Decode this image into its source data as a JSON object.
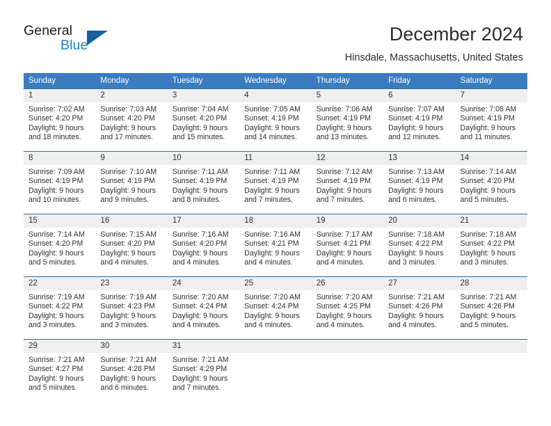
{
  "brand": {
    "name_top": "General",
    "name_bottom": "Blue",
    "accent_color": "#1a7fd4",
    "triangle_color": "#15619e"
  },
  "header": {
    "title": "December 2024",
    "location": "Hinsdale, Massachusetts, United States"
  },
  "calendar": {
    "header_bg": "#3b7cbf",
    "daynum_bg": "#efefef",
    "row_border_color": "#2e6da4",
    "weekdays": [
      "Sunday",
      "Monday",
      "Tuesday",
      "Wednesday",
      "Thursday",
      "Friday",
      "Saturday"
    ],
    "weeks": [
      [
        {
          "day": "1",
          "sunrise": "Sunrise: 7:02 AM",
          "sunset": "Sunset: 4:20 PM",
          "daylight": "Daylight: 9 hours and 18 minutes."
        },
        {
          "day": "2",
          "sunrise": "Sunrise: 7:03 AM",
          "sunset": "Sunset: 4:20 PM",
          "daylight": "Daylight: 9 hours and 17 minutes."
        },
        {
          "day": "3",
          "sunrise": "Sunrise: 7:04 AM",
          "sunset": "Sunset: 4:20 PM",
          "daylight": "Daylight: 9 hours and 15 minutes."
        },
        {
          "day": "4",
          "sunrise": "Sunrise: 7:05 AM",
          "sunset": "Sunset: 4:19 PM",
          "daylight": "Daylight: 9 hours and 14 minutes."
        },
        {
          "day": "5",
          "sunrise": "Sunrise: 7:06 AM",
          "sunset": "Sunset: 4:19 PM",
          "daylight": "Daylight: 9 hours and 13 minutes."
        },
        {
          "day": "6",
          "sunrise": "Sunrise: 7:07 AM",
          "sunset": "Sunset: 4:19 PM",
          "daylight": "Daylight: 9 hours and 12 minutes."
        },
        {
          "day": "7",
          "sunrise": "Sunrise: 7:08 AM",
          "sunset": "Sunset: 4:19 PM",
          "daylight": "Daylight: 9 hours and 11 minutes."
        }
      ],
      [
        {
          "day": "8",
          "sunrise": "Sunrise: 7:09 AM",
          "sunset": "Sunset: 4:19 PM",
          "daylight": "Daylight: 9 hours and 10 minutes."
        },
        {
          "day": "9",
          "sunrise": "Sunrise: 7:10 AM",
          "sunset": "Sunset: 4:19 PM",
          "daylight": "Daylight: 9 hours and 9 minutes."
        },
        {
          "day": "10",
          "sunrise": "Sunrise: 7:11 AM",
          "sunset": "Sunset: 4:19 PM",
          "daylight": "Daylight: 9 hours and 8 minutes."
        },
        {
          "day": "11",
          "sunrise": "Sunrise: 7:11 AM",
          "sunset": "Sunset: 4:19 PM",
          "daylight": "Daylight: 9 hours and 7 minutes."
        },
        {
          "day": "12",
          "sunrise": "Sunrise: 7:12 AM",
          "sunset": "Sunset: 4:19 PM",
          "daylight": "Daylight: 9 hours and 7 minutes."
        },
        {
          "day": "13",
          "sunrise": "Sunrise: 7:13 AM",
          "sunset": "Sunset: 4:19 PM",
          "daylight": "Daylight: 9 hours and 6 minutes."
        },
        {
          "day": "14",
          "sunrise": "Sunrise: 7:14 AM",
          "sunset": "Sunset: 4:20 PM",
          "daylight": "Daylight: 9 hours and 5 minutes."
        }
      ],
      [
        {
          "day": "15",
          "sunrise": "Sunrise: 7:14 AM",
          "sunset": "Sunset: 4:20 PM",
          "daylight": "Daylight: 9 hours and 5 minutes."
        },
        {
          "day": "16",
          "sunrise": "Sunrise: 7:15 AM",
          "sunset": "Sunset: 4:20 PM",
          "daylight": "Daylight: 9 hours and 4 minutes."
        },
        {
          "day": "17",
          "sunrise": "Sunrise: 7:16 AM",
          "sunset": "Sunset: 4:20 PM",
          "daylight": "Daylight: 9 hours and 4 minutes."
        },
        {
          "day": "18",
          "sunrise": "Sunrise: 7:16 AM",
          "sunset": "Sunset: 4:21 PM",
          "daylight": "Daylight: 9 hours and 4 minutes."
        },
        {
          "day": "19",
          "sunrise": "Sunrise: 7:17 AM",
          "sunset": "Sunset: 4:21 PM",
          "daylight": "Daylight: 9 hours and 4 minutes."
        },
        {
          "day": "20",
          "sunrise": "Sunrise: 7:18 AM",
          "sunset": "Sunset: 4:22 PM",
          "daylight": "Daylight: 9 hours and 3 minutes."
        },
        {
          "day": "21",
          "sunrise": "Sunrise: 7:18 AM",
          "sunset": "Sunset: 4:22 PM",
          "daylight": "Daylight: 9 hours and 3 minutes."
        }
      ],
      [
        {
          "day": "22",
          "sunrise": "Sunrise: 7:19 AM",
          "sunset": "Sunset: 4:22 PM",
          "daylight": "Daylight: 9 hours and 3 minutes."
        },
        {
          "day": "23",
          "sunrise": "Sunrise: 7:19 AM",
          "sunset": "Sunset: 4:23 PM",
          "daylight": "Daylight: 9 hours and 3 minutes."
        },
        {
          "day": "24",
          "sunrise": "Sunrise: 7:20 AM",
          "sunset": "Sunset: 4:24 PM",
          "daylight": "Daylight: 9 hours and 4 minutes."
        },
        {
          "day": "25",
          "sunrise": "Sunrise: 7:20 AM",
          "sunset": "Sunset: 4:24 PM",
          "daylight": "Daylight: 9 hours and 4 minutes."
        },
        {
          "day": "26",
          "sunrise": "Sunrise: 7:20 AM",
          "sunset": "Sunset: 4:25 PM",
          "daylight": "Daylight: 9 hours and 4 minutes."
        },
        {
          "day": "27",
          "sunrise": "Sunrise: 7:21 AM",
          "sunset": "Sunset: 4:26 PM",
          "daylight": "Daylight: 9 hours and 4 minutes."
        },
        {
          "day": "28",
          "sunrise": "Sunrise: 7:21 AM",
          "sunset": "Sunset: 4:26 PM",
          "daylight": "Daylight: 9 hours and 5 minutes."
        }
      ],
      [
        {
          "day": "29",
          "sunrise": "Sunrise: 7:21 AM",
          "sunset": "Sunset: 4:27 PM",
          "daylight": "Daylight: 9 hours and 5 minutes."
        },
        {
          "day": "30",
          "sunrise": "Sunrise: 7:21 AM",
          "sunset": "Sunset: 4:28 PM",
          "daylight": "Daylight: 9 hours and 6 minutes."
        },
        {
          "day": "31",
          "sunrise": "Sunrise: 7:21 AM",
          "sunset": "Sunset: 4:29 PM",
          "daylight": "Daylight: 9 hours and 7 minutes."
        },
        {
          "day": "",
          "sunrise": "",
          "sunset": "",
          "daylight": ""
        },
        {
          "day": "",
          "sunrise": "",
          "sunset": "",
          "daylight": ""
        },
        {
          "day": "",
          "sunrise": "",
          "sunset": "",
          "daylight": ""
        },
        {
          "day": "",
          "sunrise": "",
          "sunset": "",
          "daylight": ""
        }
      ]
    ]
  }
}
